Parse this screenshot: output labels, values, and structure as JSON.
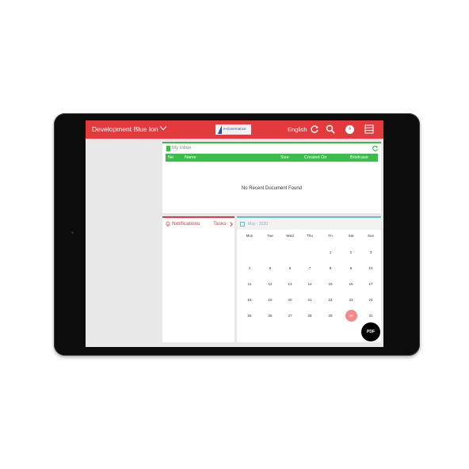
{
  "header": {
    "workspace": "Development Blue Ion",
    "logo_text": "e-Governance",
    "language": "English",
    "avatar_initial": "A"
  },
  "inbox": {
    "title": "My Inbox",
    "columns": [
      "No",
      "Name",
      "Size",
      "Created On",
      "Briefcase"
    ],
    "empty_message": "No Recent Document Found"
  },
  "notifications": {
    "title": "Notifications",
    "tasks_label": "Tasks"
  },
  "calendar": {
    "title": "May - 2020",
    "weekdays": [
      "Mon",
      "Tue",
      "Wed",
      "Thu",
      "Fri",
      "Sat",
      "Sun"
    ],
    "weeks": [
      [
        "",
        "",
        "",
        "",
        "1",
        "2",
        "3"
      ],
      [
        "4",
        "5",
        "6",
        "7",
        "8",
        "9",
        "10"
      ],
      [
        "11",
        "12",
        "13",
        "14",
        "15",
        "16",
        "17"
      ],
      [
        "18",
        "19",
        "20",
        "21",
        "22",
        "23",
        "24"
      ],
      [
        "25",
        "26",
        "27",
        "28",
        "29",
        "30",
        "31"
      ]
    ],
    "highlighted_day": "30"
  },
  "fab": {
    "label": "PDF"
  },
  "colors": {
    "accent_red": "#e53a3d",
    "accent_green": "#3bbd4a",
    "today": "#f28a8a"
  }
}
